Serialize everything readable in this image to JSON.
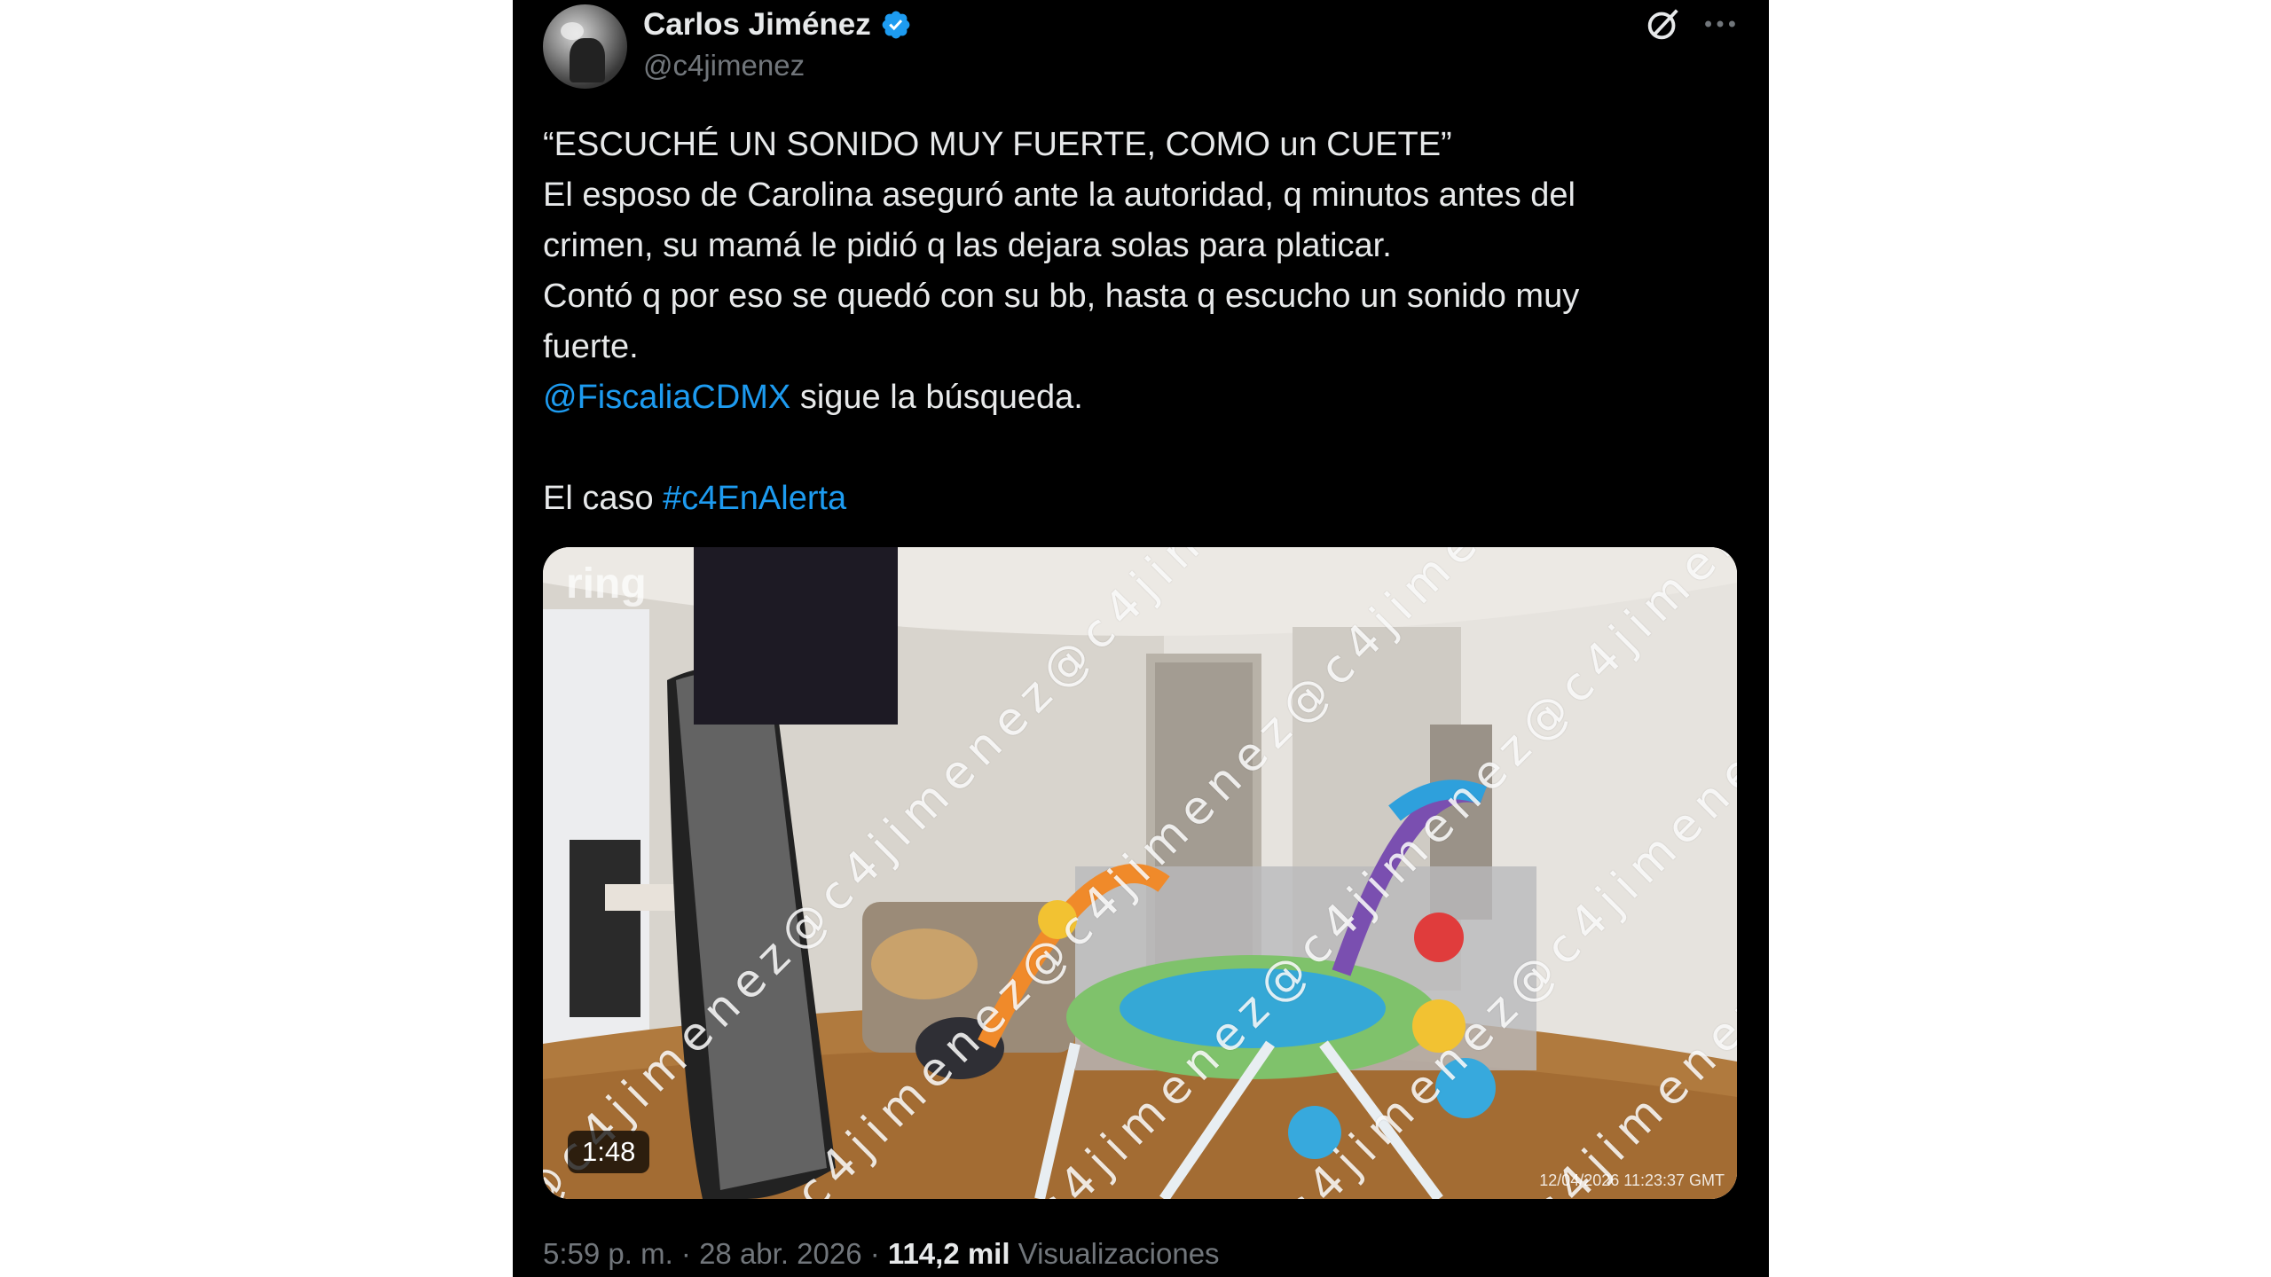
{
  "author": {
    "name": "Carlos Jiménez",
    "handle": "@c4jimenez"
  },
  "icons": {
    "verified": "verified-badge-icon",
    "grok": "grok-icon",
    "more": "more-options-icon"
  },
  "tweet": {
    "line1": "“ESCUCHÉ UN SONIDO MUY FUERTE, COMO un CUETE”",
    "line2": "El esposo de Carolina aseguró ante la autoridad, q minutos antes del",
    "line3": "crimen, su mamá le pidió q las dejara solas para platicar.",
    "line4": "Contó q por eso se quedó con su bb, hasta q escucho un sonido muy",
    "line5": "fuerte.",
    "mention": "@FiscaliaCDMX",
    "mention_suffix": " sigue la búsqueda.",
    "caso_prefix": "El caso ",
    "hashtag": "#c4EnAlerta"
  },
  "media": {
    "duration": "1:48",
    "watermark": "@c4jimenez@c4jimenez@c4jimenez",
    "cam_logo": "ring",
    "cam_timestamp": "12/04/2026 11:23:37 GMT"
  },
  "meta": {
    "time": "5:59 p. m.",
    "sep1": " · ",
    "date": "28 abr. 2026",
    "sep2": " · ",
    "views_count": "114,2 mil",
    "views_label": " Visualizaciones"
  },
  "colors": {
    "background": "#000000",
    "text": "#e7e9ea",
    "secondary": "#71767b",
    "link": "#1d9bf0"
  }
}
